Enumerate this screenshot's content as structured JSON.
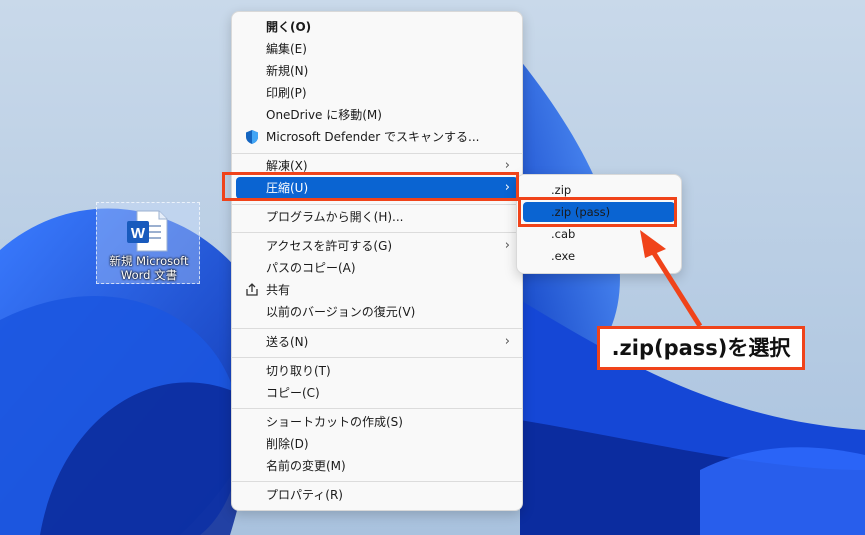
{
  "desktop": {
    "icon_label": "新規 Microsoft Word 文書",
    "icon_type": "word-document-icon"
  },
  "context_menu": {
    "items": [
      {
        "label": "開く(O)",
        "bold": true
      },
      {
        "label": "編集(E)"
      },
      {
        "label": "新規(N)"
      },
      {
        "label": "印刷(P)"
      },
      {
        "label": "OneDrive に移動(M)"
      },
      {
        "label": "Microsoft Defender でスキャンする...",
        "icon": "defender-shield-icon"
      },
      {
        "label": "解凍(X)",
        "submenu": true
      },
      {
        "label": "圧縮(U)",
        "submenu": true,
        "highlighted": true
      },
      {
        "label": "プログラムから開く(H)..."
      },
      {
        "label": "アクセスを許可する(G)",
        "submenu": true
      },
      {
        "label": "パスのコピー(A)"
      },
      {
        "label": "共有",
        "icon": "share-icon"
      },
      {
        "label": "以前のバージョンの復元(V)"
      },
      {
        "label": "送る(N)",
        "submenu": true
      },
      {
        "label": "切り取り(T)"
      },
      {
        "label": "コピー(C)"
      },
      {
        "label": "ショートカットの作成(S)"
      },
      {
        "label": "削除(D)"
      },
      {
        "label": "名前の変更(M)"
      },
      {
        "label": "プロパティ(R)"
      }
    ],
    "arrow_glyph": "›"
  },
  "submenu": {
    "items": [
      {
        "label": ".zip"
      },
      {
        "label": ".zip (pass)",
        "highlighted": true
      },
      {
        "label": ".cab"
      },
      {
        "label": ".exe"
      }
    ]
  },
  "annotation": {
    "callout_text": ".zip(pass)を選択",
    "color": "#f0431a"
  },
  "colors": {
    "highlight": "#0a64d2",
    "menu_bg": "#f9f9f9",
    "wallpaper_light": "#b8cde4",
    "wallpaper_blue": "#1a4fd0"
  }
}
